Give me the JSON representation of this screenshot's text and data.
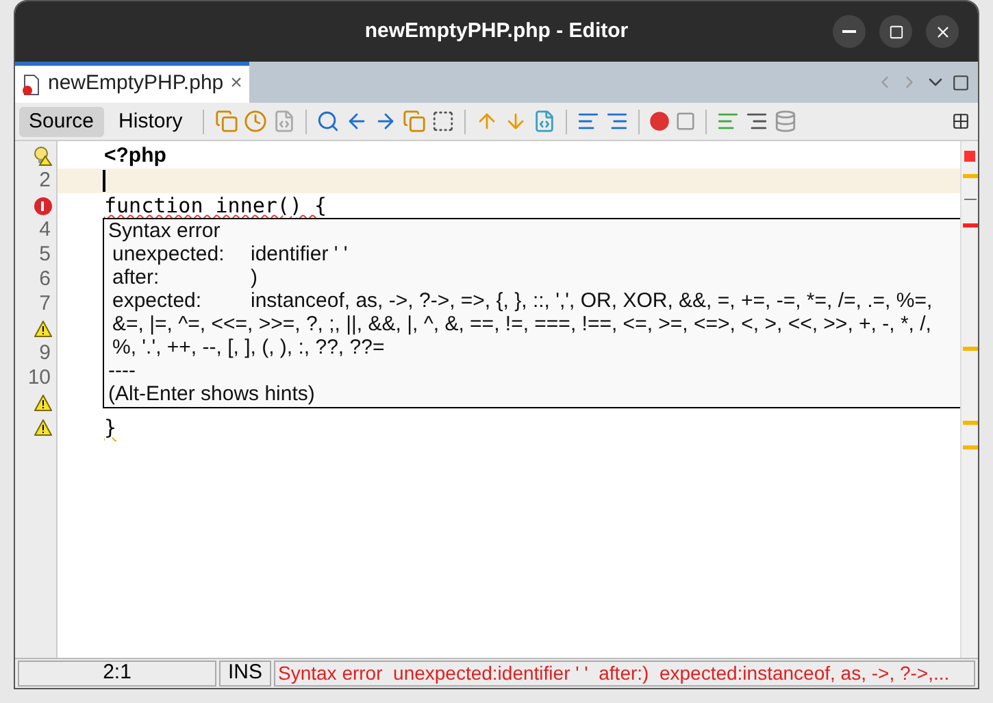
{
  "window": {
    "title": "newEmptyPHP.php - Editor"
  },
  "tabs": [
    {
      "label": "newEmptyPHP.php",
      "selected": true,
      "close": "×"
    }
  ],
  "view_tabs": [
    {
      "label": "Source",
      "selected": true
    },
    {
      "label": "History",
      "selected": false
    }
  ],
  "gutter": [
    {
      "kind": "hint"
    },
    {
      "kind": "number",
      "text": "2"
    },
    {
      "kind": "error"
    },
    {
      "kind": "number",
      "text": "4"
    },
    {
      "kind": "number",
      "text": "5"
    },
    {
      "kind": "number",
      "text": "6"
    },
    {
      "kind": "number",
      "text": "7"
    },
    {
      "kind": "warning"
    },
    {
      "kind": "number",
      "text": "9"
    },
    {
      "kind": "number",
      "text": "10"
    },
    {
      "kind": "warning"
    },
    {
      "kind": "warning"
    }
  ],
  "lines": [
    {
      "kind": "tag",
      "text": "<?php"
    },
    {
      "kind": "current"
    },
    {
      "kind": "error",
      "text": "function inner() {"
    },
    {
      "kind": "blank"
    },
    {
      "kind": "blank"
    },
    {
      "kind": "blank"
    },
    {
      "kind": "blank"
    },
    {
      "kind": "blank"
    },
    {
      "kind": "blank"
    },
    {
      "kind": "blank"
    },
    {
      "kind": "blank"
    },
    {
      "kind": "warning",
      "text": "}"
    }
  ],
  "tooltip": {
    "title": "Syntax error",
    "rows": [
      {
        "label": "unexpected:",
        "value": "identifier ' '"
      },
      {
        "label": "after:",
        "value": ")"
      },
      {
        "label": "expected:",
        "value": "instanceof, as, ->, ?->, =>, {, }, ::, ',', OR, XOR, &&, =, +=, -=, *=, /=, .=, %=, &=, |=, ^=, <<=, >>=, ?, ;, ||, &&, |, ^, &, ==, !=, ===, !==, <=, >=, <=>, <, >, <<, >>, +, -, *, /, %, '.', ++, --, [, ], (, ), :, ??, ??="
      }
    ],
    "separator": "----",
    "hint": "(Alt-Enter shows hints)"
  },
  "status_bar": {
    "position": "2:1",
    "mode": "INS",
    "message": "Syntax error  unexpected:identifier ' '  after:)  expected:instanceof, as, ->, ?->,..."
  }
}
